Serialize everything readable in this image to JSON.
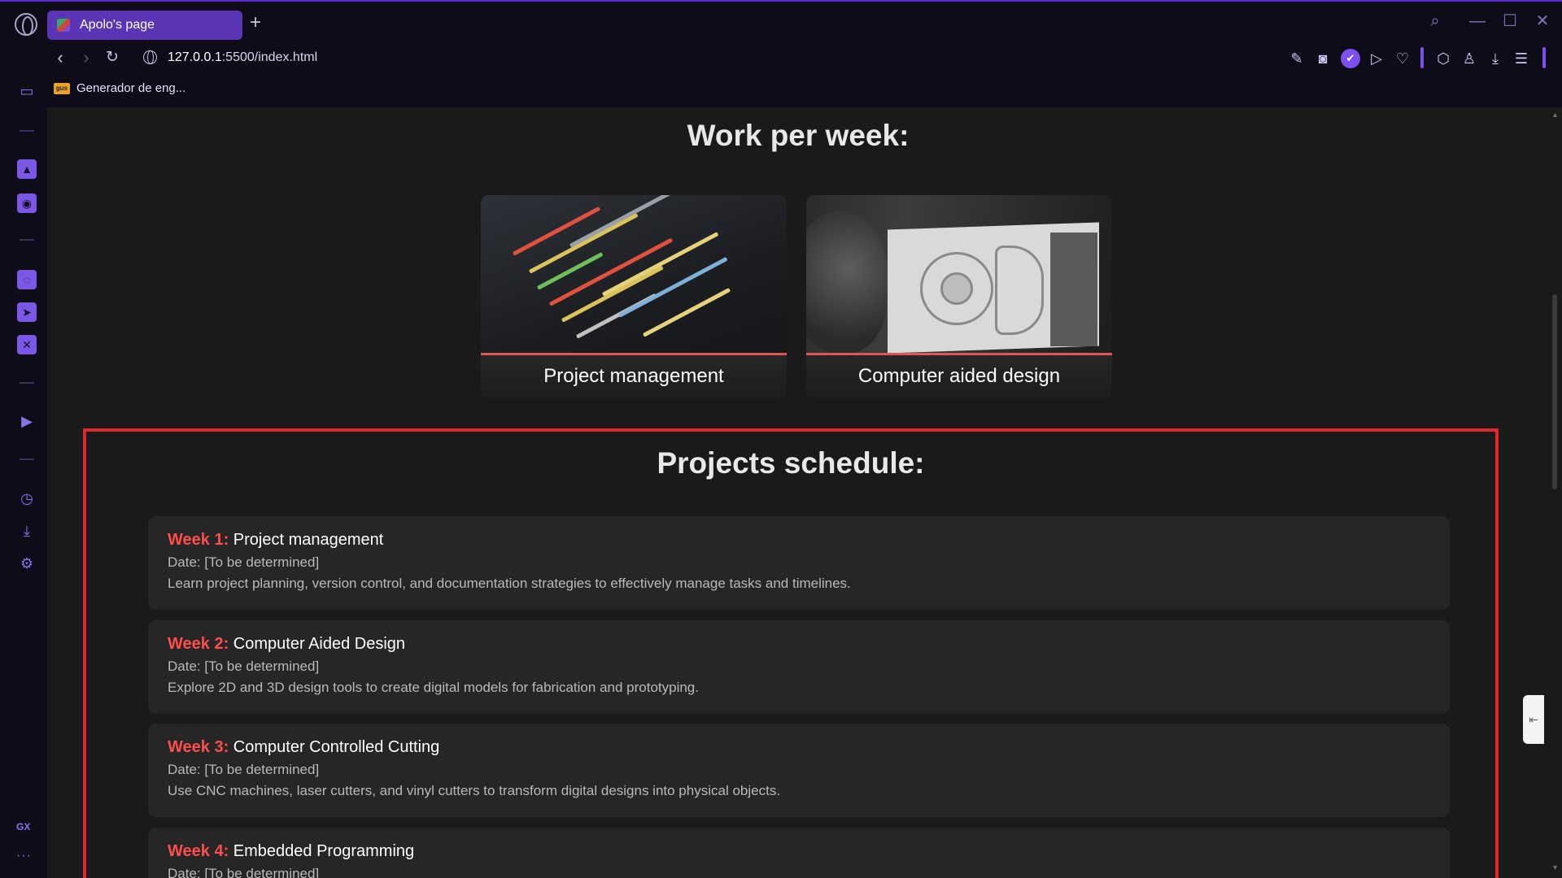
{
  "browser": {
    "tab_title": "Apolo's page",
    "new_tab": "+",
    "url_host": "127.0.0.1",
    "url_rest": ":5500/index.html",
    "bookmark": "Generador de eng...",
    "bookmark_badge": "gus",
    "accent_color": "#7c4ff0"
  },
  "sidebar": {
    "gx_label": "GX",
    "more": "···"
  },
  "page": {
    "work_title": "Work per week:",
    "cards": [
      {
        "label": "Project management",
        "image": "code-screen-photo"
      },
      {
        "label": "Computer aided design",
        "image": "cad-modeling-photo"
      }
    ],
    "schedule_title": "Projects schedule:",
    "schedule": [
      {
        "week": "Week 1:",
        "title": "Project management",
        "date": "Date: [To be determined]",
        "desc": "Learn project planning, version control, and documentation strategies to effectively manage tasks and timelines."
      },
      {
        "week": "Week 2:",
        "title": "Computer Aided Design",
        "date": "Date: [To be determined]",
        "desc": "Explore 2D and 3D design tools to create digital models for fabrication and prototyping."
      },
      {
        "week": "Week 3:",
        "title": "Computer Controlled Cutting",
        "date": "Date: [To be determined]",
        "desc": "Use CNC machines, laser cutters, and vinyl cutters to transform digital designs into physical objects."
      },
      {
        "week": "Week 4:",
        "title": "Embedded Programming",
        "date": "Date: [To be determined]",
        "desc": ""
      }
    ],
    "highlight_color": "#e02a2a",
    "week_color": "#ff4d4d"
  }
}
